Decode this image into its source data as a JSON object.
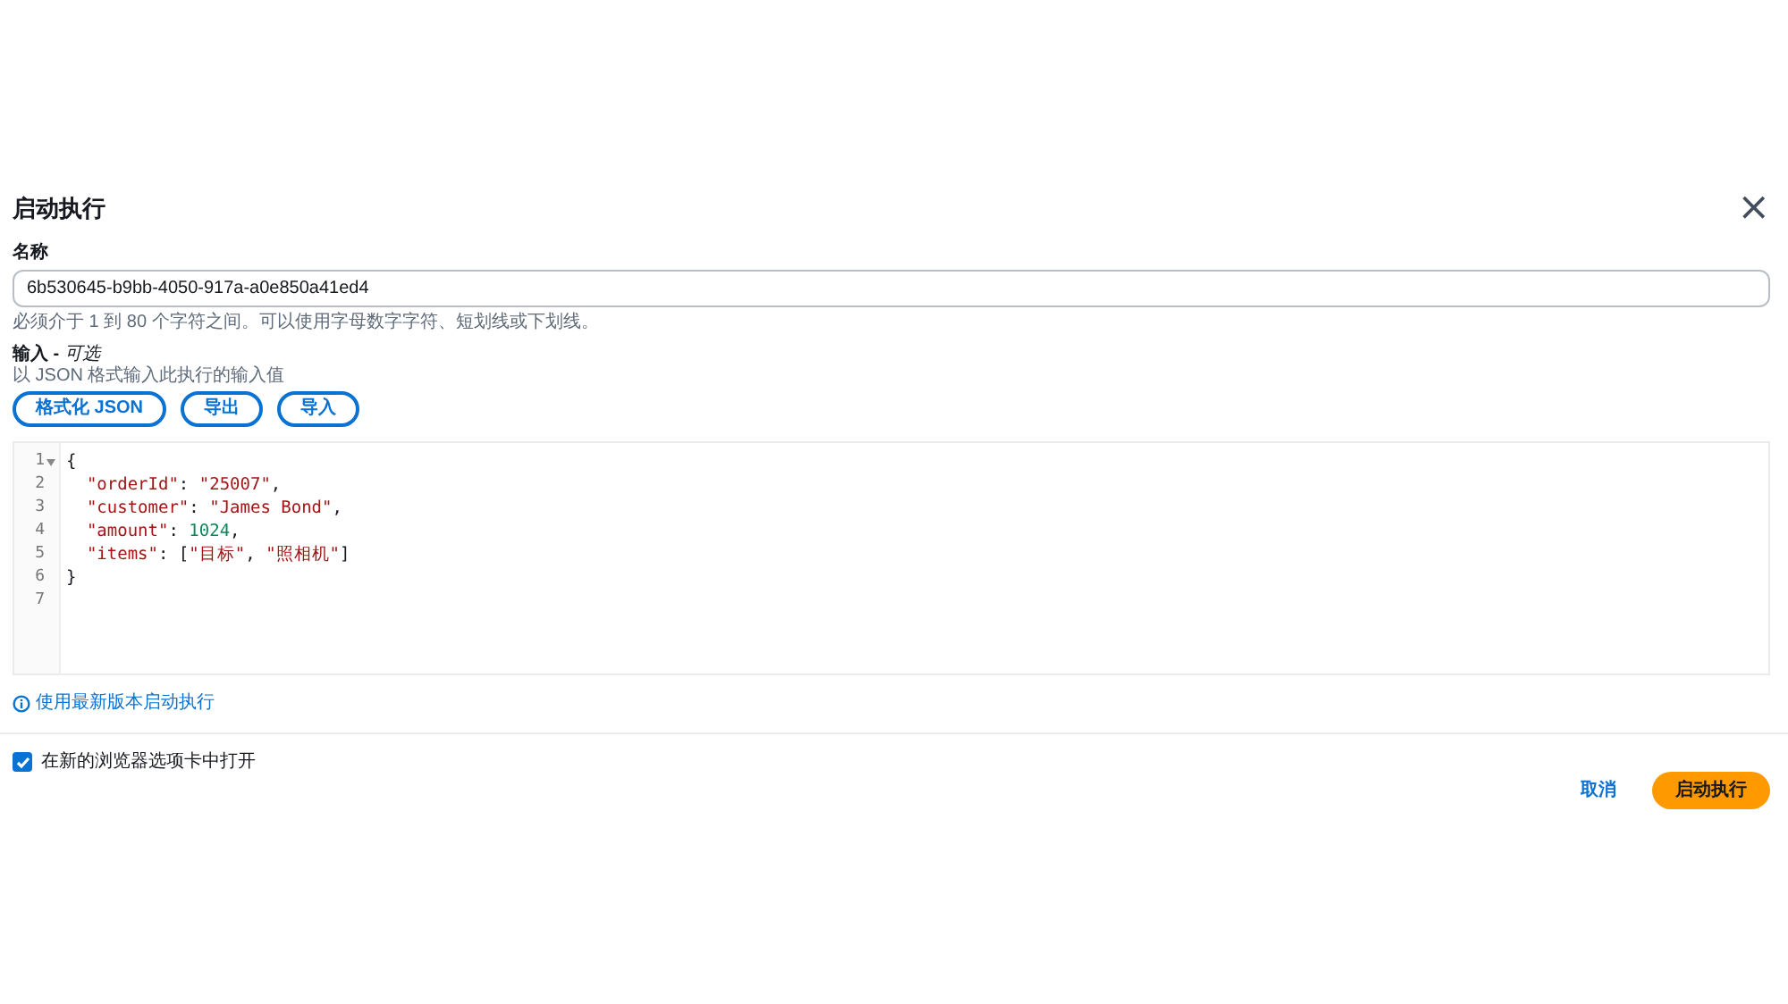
{
  "dialog": {
    "title": "启动执行",
    "close_label": "×"
  },
  "name_field": {
    "label": "名称",
    "value": "6b530645-b9bb-4050-917a-a0e850a41ed4",
    "hint": "必须介于 1 到 80 个字符之间。可以使用字母数字字符、短划线或下划线。"
  },
  "input_section": {
    "label": "输入 - ",
    "label_optional": "可选",
    "description": "以 JSON 格式输入此执行的输入值",
    "buttons": [
      "格式化 JSON",
      "导出",
      "导入"
    ],
    "editor_lines": [
      {
        "number": "1",
        "foldable": true,
        "tokens": [
          {
            "text": "{",
            "kind": "punct"
          }
        ]
      },
      {
        "number": "2",
        "foldable": false,
        "tokens": [
          {
            "text": "  \"orderId\"",
            "kind": "string"
          },
          {
            "text": ": ",
            "kind": "punct"
          },
          {
            "text": "\"25007\"",
            "kind": "string"
          },
          {
            "text": ",",
            "kind": "punct"
          }
        ]
      },
      {
        "number": "3",
        "foldable": false,
        "tokens": [
          {
            "text": "  \"customer\"",
            "kind": "string"
          },
          {
            "text": ": ",
            "kind": "punct"
          },
          {
            "text": "\"James Bond\"",
            "kind": "string"
          },
          {
            "text": ",",
            "kind": "punct"
          }
        ]
      },
      {
        "number": "4",
        "foldable": false,
        "tokens": [
          {
            "text": "  \"amount\"",
            "kind": "string"
          },
          {
            "text": ": ",
            "kind": "punct"
          },
          {
            "text": "1024",
            "kind": "number"
          },
          {
            "text": ",",
            "kind": "punct"
          }
        ]
      },
      {
        "number": "5",
        "foldable": false,
        "tokens": [
          {
            "text": "  \"items\"",
            "kind": "string"
          },
          {
            "text": ": [",
            "kind": "punct"
          },
          {
            "text": "\"目标\"",
            "kind": "string"
          },
          {
            "text": ", ",
            "kind": "punct"
          },
          {
            "text": "\"照相机\"",
            "kind": "string"
          },
          {
            "text": "]",
            "kind": "punct"
          }
        ]
      },
      {
        "number": "6",
        "foldable": false,
        "tokens": [
          {
            "text": "}",
            "kind": "punct"
          }
        ]
      },
      {
        "number": "7",
        "foldable": false
      }
    ],
    "version_link": "使用最新版本启动执行"
  },
  "open_in_new_tab": {
    "label": "在新的浏览器选项卡中打开",
    "checked": true
  },
  "footer": {
    "cancel": "取消",
    "submit": "启动执行"
  }
}
